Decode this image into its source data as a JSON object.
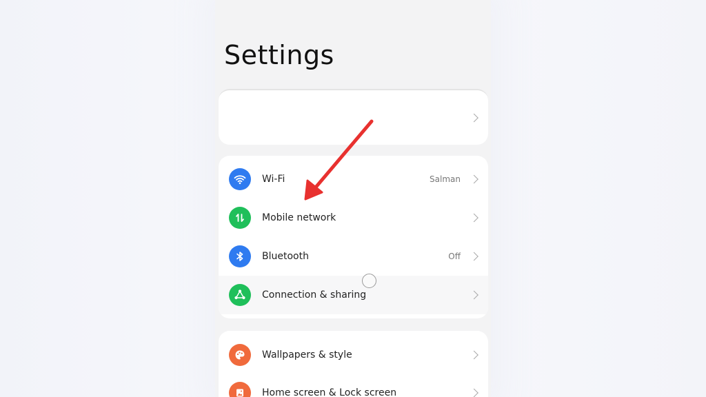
{
  "page": {
    "title": "Settings"
  },
  "account_card": {
    "label": ""
  },
  "connections": {
    "items": [
      {
        "label": "Wi-Fi",
        "value": "Salman",
        "icon": "wifi-icon",
        "icon_color": "#2f7bf0"
      },
      {
        "label": "Mobile network",
        "value": "",
        "icon": "mobile-data-icon",
        "icon_color": "#1fbf5a"
      },
      {
        "label": "Bluetooth",
        "value": "Off",
        "icon": "bluetooth-icon",
        "icon_color": "#2f7bf0"
      },
      {
        "label": "Connection & sharing",
        "value": "",
        "icon": "connection-sharing-icon",
        "icon_color": "#1fbf5a"
      }
    ]
  },
  "personalization": {
    "items": [
      {
        "label": "Wallpapers & style",
        "value": "",
        "icon": "palette-icon",
        "icon_color": "#f06a3c"
      },
      {
        "label": "Home screen & Lock screen",
        "value": "",
        "icon": "home-lock-icon",
        "icon_color": "#f06a3c"
      }
    ]
  },
  "annotation": {
    "arrow_color": "#e8312f"
  }
}
